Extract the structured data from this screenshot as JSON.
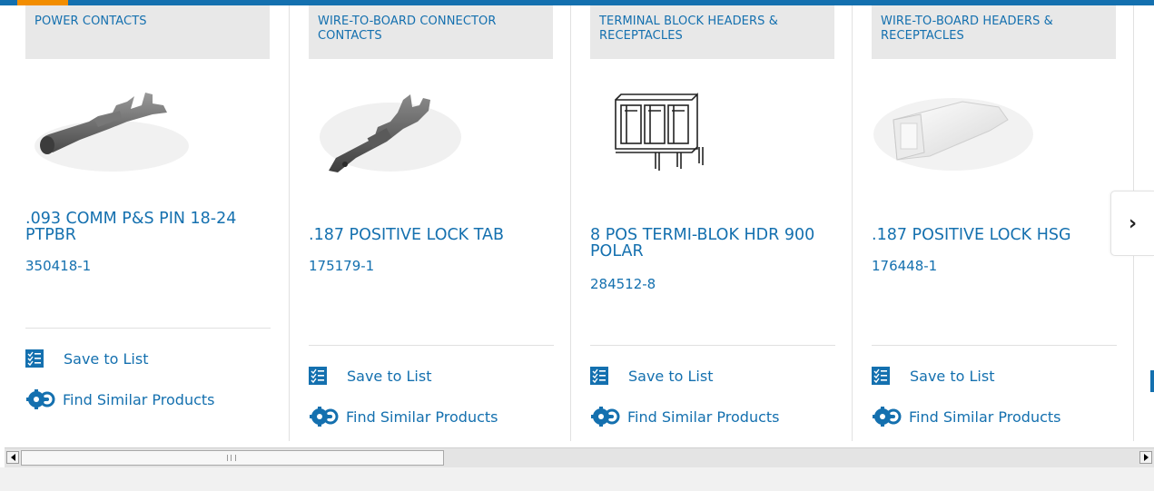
{
  "products": [
    {
      "category": "POWER CONTACTS",
      "name": ".093 COMM P&S PIN 18-24 PTPBR",
      "part_number": "350418-1",
      "save_label": "Save to List",
      "similar_label": "Find Similar Products",
      "image_icon": "pin-contact-image"
    },
    {
      "category": "WIRE-TO-BOARD CONNECTOR CONTACTS",
      "name": ".187 POSITIVE LOCK TAB",
      "part_number": "175179-1",
      "save_label": "Save to List",
      "similar_label": "Find Similar Products",
      "image_icon": "tab-contact-image"
    },
    {
      "category": "TERMINAL BLOCK HEADERS & RECEPTACLES",
      "name": "8 POS TERMI-BLOK HDR 900 POLAR",
      "part_number": "284512-8",
      "save_label": "Save to List",
      "similar_label": "Find Similar Products",
      "image_icon": "terminal-block-header-image"
    },
    {
      "category": "WIRE-TO-BOARD HEADERS & RECEPTACLES",
      "name": ".187 POSITIVE LOCK HSG",
      "part_number": "176448-1",
      "save_label": "Save to List",
      "similar_label": "Find Similar Products",
      "image_icon": "housing-image"
    }
  ],
  "carousel": {
    "next_icon": "chevron-right-icon",
    "next_glyph": "›"
  },
  "colors": {
    "brand_blue": "#1470af",
    "accent_orange": "#f28d00",
    "category_bg": "#e8e8e8"
  }
}
